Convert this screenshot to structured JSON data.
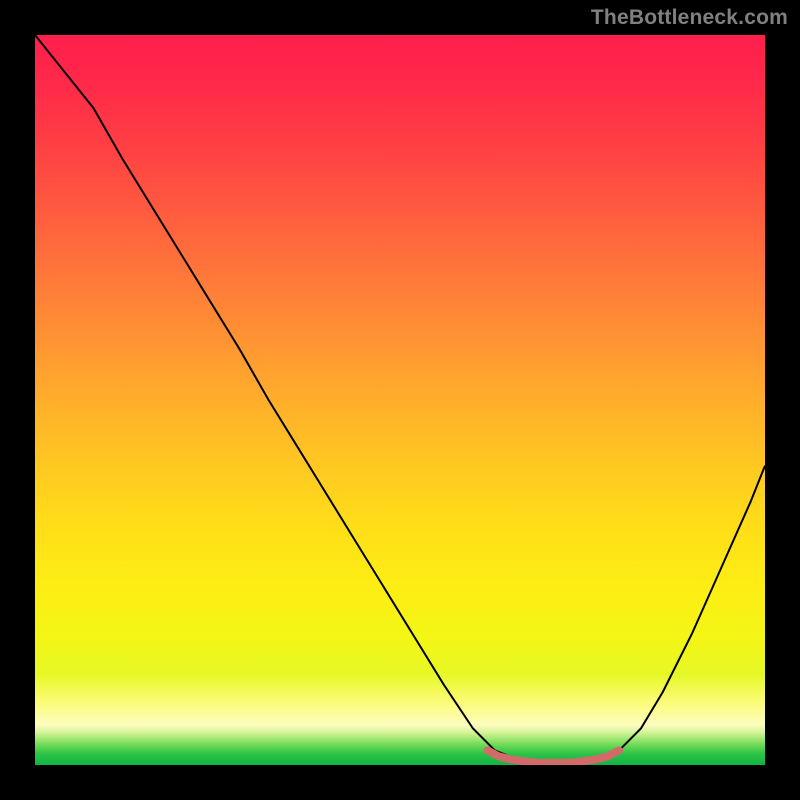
{
  "watermark": "TheBottleneck.com",
  "chart_data": {
    "type": "line",
    "title": "",
    "xlabel": "",
    "ylabel": "",
    "xlim": [
      0,
      100
    ],
    "ylim": [
      0,
      100
    ],
    "grid": false,
    "series": [
      {
        "name": "curve",
        "color": "#000000",
        "x": [
          0,
          4,
          8,
          12,
          16,
          20,
          24,
          28,
          32,
          36,
          40,
          44,
          48,
          52,
          56,
          60,
          63,
          66,
          70,
          74,
          78,
          80,
          83,
          86,
          90,
          94,
          98,
          100
        ],
        "y": [
          100,
          95,
          90,
          83,
          76.5,
          70,
          63.5,
          57,
          50,
          43.5,
          37,
          30.5,
          24,
          17.5,
          11,
          5,
          2,
          0.8,
          0.2,
          0.2,
          0.8,
          2,
          5,
          10,
          18,
          27,
          36,
          41
        ]
      },
      {
        "name": "bottom-highlight",
        "color": "#d26a6a",
        "x": [
          62,
          63.5,
          65,
          67,
          69,
          71,
          73,
          75,
          77,
          78.5,
          80
        ],
        "y": [
          2.0,
          1.2,
          0.8,
          0.5,
          0.3,
          0.3,
          0.3,
          0.5,
          0.8,
          1.2,
          2.0
        ]
      }
    ],
    "background_gradient": {
      "stops": [
        {
          "offset": 0.0,
          "color": "#ff1f4c"
        },
        {
          "offset": 0.075,
          "color": "#ff2b49"
        },
        {
          "offset": 0.15,
          "color": "#ff3f44"
        },
        {
          "offset": 0.225,
          "color": "#ff5640"
        },
        {
          "offset": 0.3,
          "color": "#ff6e3c"
        },
        {
          "offset": 0.375,
          "color": "#ff8636"
        },
        {
          "offset": 0.45,
          "color": "#ff9e30"
        },
        {
          "offset": 0.525,
          "color": "#ffb528"
        },
        {
          "offset": 0.6,
          "color": "#ffcb20"
        },
        {
          "offset": 0.675,
          "color": "#ffde18"
        },
        {
          "offset": 0.75,
          "color": "#fded13"
        },
        {
          "offset": 0.825,
          "color": "#f4f615"
        },
        {
          "offset": 0.875,
          "color": "#e6f825"
        },
        {
          "offset": 0.915,
          "color": "#fbfc7a"
        },
        {
          "offset": 0.945,
          "color": "#fdfdc0"
        },
        {
          "offset": 0.955,
          "color": "#d8f49a"
        },
        {
          "offset": 0.965,
          "color": "#9be66f"
        },
        {
          "offset": 0.975,
          "color": "#5fd551"
        },
        {
          "offset": 0.985,
          "color": "#2cc346"
        },
        {
          "offset": 1.0,
          "color": "#0eb445"
        }
      ]
    }
  }
}
